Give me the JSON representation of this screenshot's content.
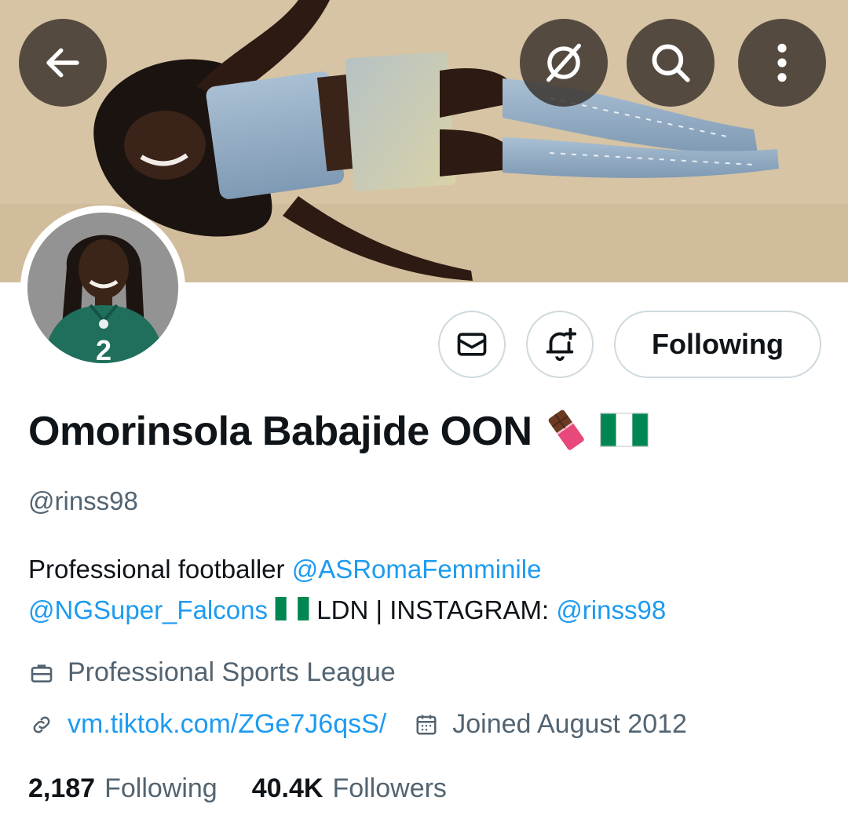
{
  "header": {
    "back_icon": "arrow-left-icon",
    "grok_icon": "grok-icon",
    "search_icon": "search-icon",
    "more_icon": "more-vertical-icon"
  },
  "profile": {
    "display_name": "Omorinsola Babajide OON",
    "name_emojis": [
      "chocolate-bar-emoji",
      "nigeria-flag-emoji"
    ],
    "handle": "@rinss98",
    "avatar_jersey_number": "2"
  },
  "actions": {
    "message_icon": "envelope-icon",
    "notify_icon": "bell-plus-icon",
    "follow_label": "Following"
  },
  "bio": {
    "part1": "Professional footballer ",
    "mention1": "@ASRomaFemminile",
    "mention2": "@NGSuper_Falcons",
    "part2": " LDN | INSTAGRAM: ",
    "mention3": "@rinss98"
  },
  "meta": {
    "category": "Professional Sports League",
    "website": "vm.tiktok.com/ZGe7J6qsS/",
    "joined": "Joined August 2012"
  },
  "stats": {
    "following_count": "2,187",
    "following_label": "Following",
    "followers_count": "40.4K",
    "followers_label": "Followers"
  },
  "colors": {
    "link": "#1d9bf0",
    "text": "#0f1419",
    "secondary": "#536471",
    "border": "#cfd9de"
  }
}
